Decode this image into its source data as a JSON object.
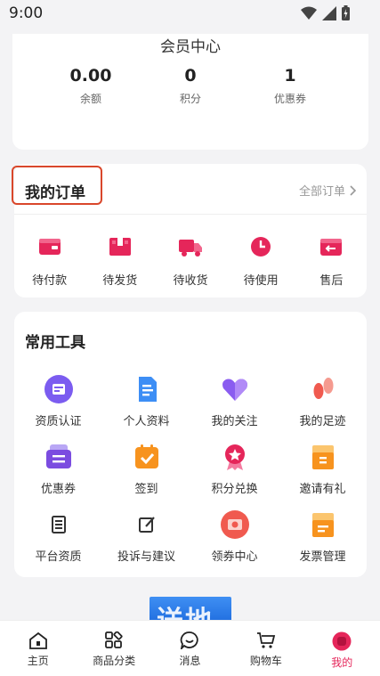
{
  "status_bar": {
    "time": "9:00"
  },
  "member": {
    "title": "会员中心",
    "stats": [
      {
        "value": "0.00",
        "label": "余额"
      },
      {
        "value": "0",
        "label": "积分"
      },
      {
        "value": "1",
        "label": "优惠券"
      }
    ]
  },
  "orders": {
    "title": "我的订单",
    "all_label": "全部订单",
    "items": [
      {
        "label": "待付款",
        "icon": "wallet-icon"
      },
      {
        "label": "待发货",
        "icon": "package-icon"
      },
      {
        "label": "待收货",
        "icon": "truck-icon"
      },
      {
        "label": "待使用",
        "icon": "clock-icon"
      },
      {
        "label": "售后",
        "icon": "return-icon"
      }
    ]
  },
  "tools": {
    "title": "常用工具",
    "items": [
      {
        "label": "资质认证",
        "icon": "certificate-icon"
      },
      {
        "label": "个人资料",
        "icon": "document-icon"
      },
      {
        "label": "我的关注",
        "icon": "heart-icon"
      },
      {
        "label": "我的足迹",
        "icon": "footprint-icon"
      },
      {
        "label": "优惠券",
        "icon": "coupon-icon"
      },
      {
        "label": "签到",
        "icon": "checkin-icon"
      },
      {
        "label": "积分兑换",
        "icon": "medal-icon"
      },
      {
        "label": "邀请有礼",
        "icon": "gift-icon"
      },
      {
        "label": "平台资质",
        "icon": "building-icon"
      },
      {
        "label": "投诉与建议",
        "icon": "edit-icon"
      },
      {
        "label": "领券中心",
        "icon": "ticket-icon"
      },
      {
        "label": "发票管理",
        "icon": "invoice-icon"
      }
    ]
  },
  "banner": {
    "text": "送地"
  },
  "tabbar": {
    "items": [
      {
        "label": "主页",
        "icon": "home-icon",
        "active": false
      },
      {
        "label": "商品分类",
        "icon": "category-icon",
        "active": false
      },
      {
        "label": "消息",
        "icon": "message-icon",
        "active": false
      },
      {
        "label": "购物车",
        "icon": "cart-icon",
        "active": false
      },
      {
        "label": "我的",
        "icon": "profile-icon",
        "active": true
      }
    ]
  },
  "colors": {
    "accent": "#e5265a",
    "highlight_border": "#d9472b",
    "tool_purple": "#7b5cf0",
    "tool_orange": "#f7931e",
    "tool_blue": "#3d8ef5"
  }
}
